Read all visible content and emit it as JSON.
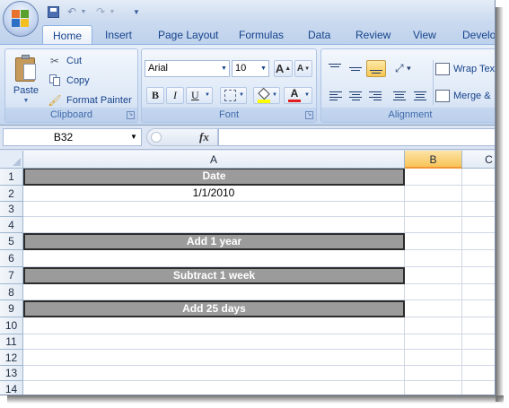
{
  "quick_access": {
    "save_icon": "save-icon",
    "undo_icon": "undo-icon",
    "redo_icon": "redo-icon"
  },
  "tabs": [
    {
      "label": "Home",
      "active": true
    },
    {
      "label": "Insert"
    },
    {
      "label": "Page Layout"
    },
    {
      "label": "Formulas"
    },
    {
      "label": "Data"
    },
    {
      "label": "Review"
    },
    {
      "label": "View"
    },
    {
      "label": "Develo"
    }
  ],
  "clipboard": {
    "paste_label": "Paste",
    "cut_label": "Cut",
    "copy_label": "Copy",
    "format_painter_label": "Format Painter",
    "group_label": "Clipboard"
  },
  "font": {
    "name": "Arial",
    "size": "10",
    "bold_label": "B",
    "italic_label": "I",
    "underline_label": "U",
    "grow_label": "A",
    "shrink_label": "A",
    "color_label": "A",
    "fill_color": "#ffff00",
    "font_color": "#e11d1d",
    "group_label": "Font"
  },
  "alignment": {
    "wrap_label": "Wrap Tex",
    "merge_label": "Merge &",
    "group_label": "Alignment"
  },
  "formula_bar": {
    "name_box": "B32",
    "fx_label": "fx",
    "content": ""
  },
  "columns": [
    "A",
    "B",
    "C"
  ],
  "rows": [
    "1",
    "2",
    "3",
    "4",
    "5",
    "6",
    "7",
    "8",
    "9",
    "10",
    "11",
    "12",
    "13",
    "14"
  ],
  "cells": {
    "A1": "Date",
    "A2": "1/1/2010",
    "A5": "Add 1 year",
    "A7": "Subtract 1 week",
    "A9": "Add 25 days"
  },
  "colors": {
    "banner_fill": "#9b9b9b",
    "selected_column_header": "#f8c458",
    "ribbon_accent": "#15428b"
  }
}
